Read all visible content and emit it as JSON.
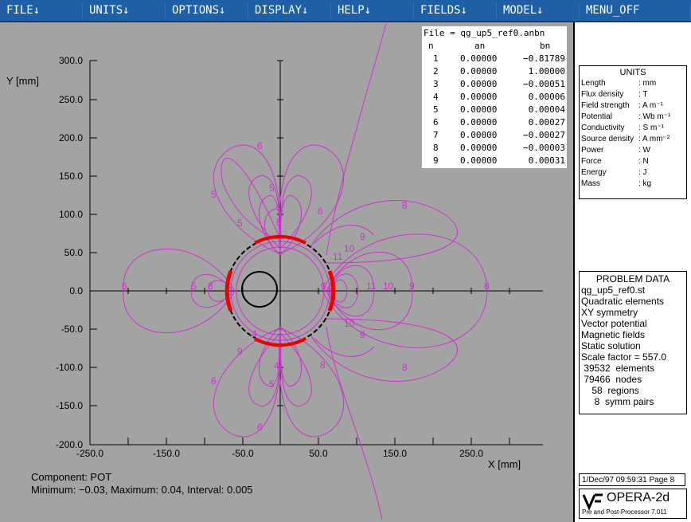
{
  "menu": [
    "FILE↓",
    "UNITS↓",
    "OPTIONS↓",
    "DISPLAY↓",
    "HELP↓",
    "FIELDS↓",
    "MODEL↓",
    "MENU_OFF"
  ],
  "colors": {
    "menubar": "#1f5fa6",
    "plot_bg": "#a3a3a3",
    "contour": "#cc33cc",
    "coil": "#ee0000"
  },
  "plot": {
    "y_axis_label": "Y [mm]",
    "x_axis_label": "X [mm]",
    "y_ticks": [
      "300.0",
      "250.0",
      "200.0",
      "150.0",
      "100.0",
      "50.0",
      "0.0",
      "-50.0",
      "-100.0",
      "-150.0",
      "-200.0"
    ],
    "x_ticks": [
      "-250.0",
      "-150.0",
      "-50.0",
      "50.0",
      "150.0",
      "250.0"
    ],
    "contour_labels": [
      "6",
      "5",
      "5",
      "4",
      "6",
      "8",
      "9",
      "10",
      "11",
      "9",
      "8",
      "6",
      "5",
      "5",
      "6",
      "4",
      "5",
      "6",
      "8",
      "9",
      "10",
      "11",
      "10",
      "9",
      "8",
      "6",
      "4",
      "5",
      "6"
    ],
    "component": "Component: POT",
    "range_text": "Minimum: −0.03,  Maximum: 0.04,  Interval: 0.005"
  },
  "coefficients": {
    "file": "File = qg_up5_ref0.anbn",
    "headers": [
      "n",
      "an",
      "bn"
    ],
    "rows": [
      [
        "1",
        "0.00000",
        "−0.81789"
      ],
      [
        "2",
        "0.00000",
        "1.00000"
      ],
      [
        "3",
        "0.00000",
        "−0.00051"
      ],
      [
        "4",
        "0.00000",
        "0.00006"
      ],
      [
        "5",
        "0.00000",
        "0.00004"
      ],
      [
        "6",
        "0.00000",
        "0.00027"
      ],
      [
        "7",
        "0.00000",
        "−0.00027"
      ],
      [
        "8",
        "0.00000",
        "−0.00003"
      ],
      [
        "9",
        "0.00000",
        "0.00031"
      ]
    ]
  },
  "units": {
    "title": "UNITS",
    "rows": [
      [
        "Length",
        ": mm"
      ],
      [
        "Flux density",
        ": T"
      ],
      [
        "Field strength",
        ": A m⁻¹"
      ],
      [
        "Potential",
        ": Wb m⁻¹"
      ],
      [
        "Conductivity",
        ": S m⁻¹"
      ],
      [
        "Source density",
        ": A mm⁻²"
      ],
      [
        "Power",
        ": W"
      ],
      [
        "Force",
        ": N"
      ],
      [
        "Energy",
        ": J"
      ],
      [
        "Mass",
        ": kg"
      ]
    ]
  },
  "problem": {
    "title": "PROBLEM DATA",
    "lines": [
      "qg_up5_ref0.st",
      "Quadratic elements",
      "XY symmetry",
      "Vector potential",
      "Magnetic fields",
      "Static solution",
      "Scale factor = 557.0",
      " 39532  elements",
      " 79466  nodes",
      "    58  regions",
      "     8  symm pairs"
    ]
  },
  "footer": {
    "timestamp": "1/Dec/97 09:59:31 Page 8",
    "logo_text": "OPERA-2d",
    "logo_sub": "Pre and Post-Processor 7.011"
  }
}
